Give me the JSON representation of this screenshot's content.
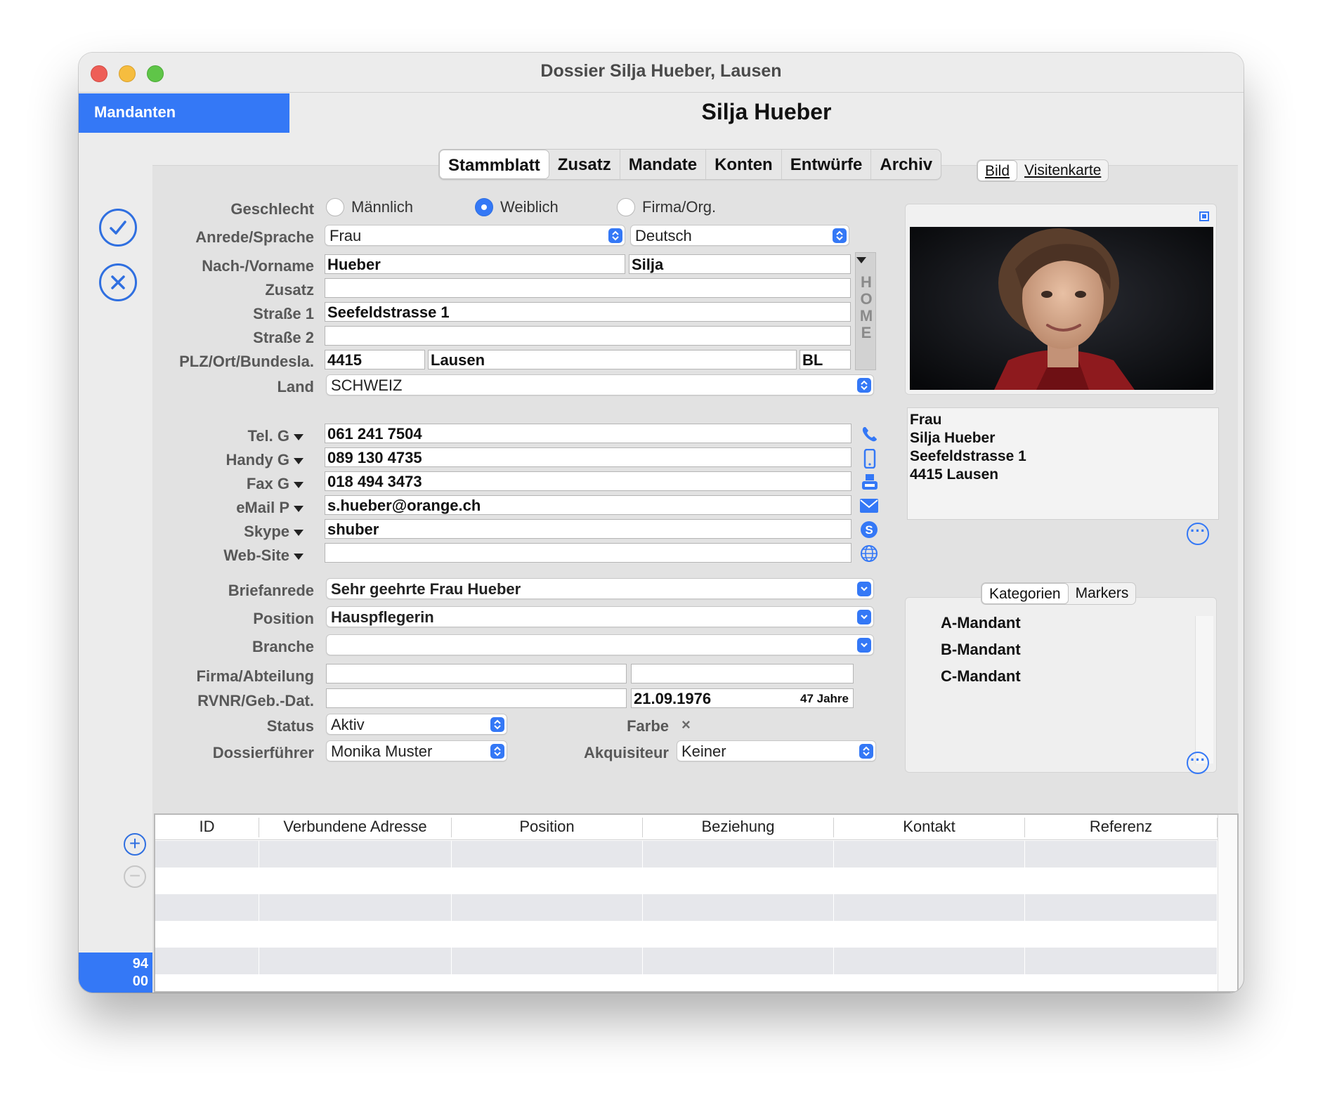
{
  "window": {
    "title": "Dossier Silja Hueber, Lausen"
  },
  "sidebar": {
    "mandanten_label": "Mandanten",
    "counter_line1": "94",
    "counter_line2": "00"
  },
  "header": {
    "person_name": "Silja Hueber"
  },
  "tabs": [
    "Stammblatt",
    "Zusatz",
    "Mandate",
    "Konten",
    "Entwürfe",
    "Archiv"
  ],
  "form": {
    "geschlecht_label": "Geschlecht",
    "gender_options": [
      "Männlich",
      "Weiblich",
      "Firma/Org."
    ],
    "gender_selected": "Weiblich",
    "anrede_label": "Anrede/Sprache",
    "anrede_value": "Frau",
    "sprache_value": "Deutsch",
    "name_label": "Nach-/Vorname",
    "nachname": "Hueber",
    "vorname": "Silja",
    "zusatz_label": "Zusatz",
    "zusatz_value": "",
    "strasse1_label": "Straße 1",
    "strasse1_value": "Seefeldstrasse 1",
    "strasse2_label": "Straße 2",
    "strasse2_value": "",
    "plz_label": "PLZ/Ort/Bundesla.",
    "plz_value": "4415",
    "ort_value": "Lausen",
    "bundesland_value": "BL",
    "land_label": "Land",
    "land_value": "SCHWEIZ",
    "home_label": "HOME",
    "tel_label": "Tel. G",
    "tel_value": "061 241 7504",
    "handy_label": "Handy G",
    "handy_value": "089 130 4735",
    "fax_label": "Fax G",
    "fax_value": "018 494 3473",
    "email_label": "eMail P",
    "email_value": "s.hueber@orange.ch",
    "skype_label": "Skype",
    "skype_value": "shuber",
    "website_label": "Web-Site",
    "website_value": "",
    "briefanrede_label": "Briefanrede",
    "briefanrede_value": "Sehr geehrte Frau Hueber",
    "position_label": "Position",
    "position_value": "Hauspflegerin",
    "branche_label": "Branche",
    "branche_value": "",
    "firma_label": "Firma/Abteilung",
    "firma_value": "",
    "abteilung_value": "",
    "rvnr_label": "RVNR/Geb.-Dat.",
    "rvnr_value": "",
    "gebdat_value": "21.09.1976",
    "alter_value": "47 Jahre",
    "status_label": "Status",
    "status_value": "Aktiv",
    "farbe_label": "Farbe",
    "farbe_value": "×",
    "dossierfuehrer_label": "Dossierführer",
    "dossierfuehrer_value": "Monika Muster",
    "akquisiteur_label": "Akquisiteur",
    "akquisiteur_value": "Keiner"
  },
  "right_panel": {
    "photo_tabs": [
      "Bild",
      "Visitenkarte"
    ],
    "address_lines": [
      "Frau",
      "Silja Hueber",
      "Seefeldstrasse 1",
      "4415 Lausen"
    ],
    "category_tabs": [
      "Kategorien",
      "Markers"
    ],
    "categories": [
      "A-Mandant",
      "B-Mandant",
      "C-Mandant"
    ]
  },
  "table": {
    "columns": [
      "ID",
      "Verbundene Adresse",
      "Position",
      "Beziehung",
      "Kontakt",
      "Referenz"
    ],
    "rows": []
  },
  "colors": {
    "accent": "#3478f6",
    "panel": "#e2e2e2",
    "window": "#ececec"
  },
  "icons": [
    "checkmark-circle-icon",
    "xmark-circle-icon",
    "phone-icon",
    "mobile-icon",
    "fax-icon",
    "mail-icon",
    "skype-icon",
    "globe-icon",
    "plus-circle-icon",
    "minus-circle-icon",
    "ellipsis-circle-icon"
  ]
}
